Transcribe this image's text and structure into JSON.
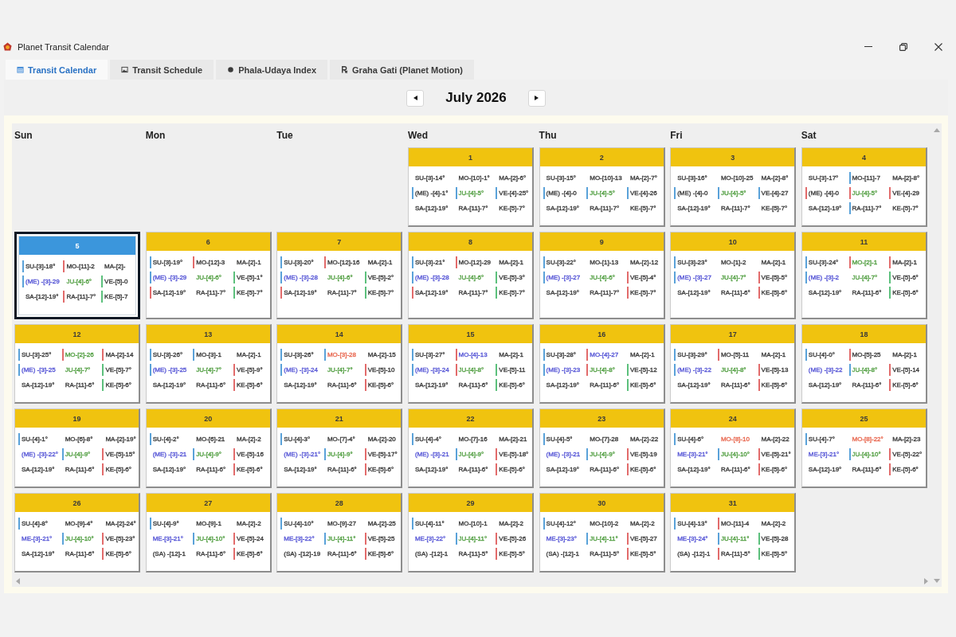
{
  "window": {
    "title": "Planet Transit Calendar"
  },
  "tabs": [
    {
      "label": "Transit Calendar",
      "selected": true
    },
    {
      "label": "Transit Schedule",
      "selected": false
    },
    {
      "label": "Phala-Udaya Index",
      "selected": false
    },
    {
      "label": "Graha Gati (Planet Motion)",
      "selected": false
    }
  ],
  "calendar": {
    "month": "July 2026",
    "weekdays": [
      "Sun",
      "Mon",
      "Tue",
      "Wed",
      "Thu",
      "Fri",
      "Sat"
    ],
    "weeks": [
      [
        {
          "kind": "blank"
        },
        {
          "kind": "blank"
        },
        {
          "kind": "blank"
        },
        {
          "kind": "day",
          "date": "1",
          "selected": false,
          "entries": [
            {
              "text": "SU-[3]-14°"
            },
            {
              "text": "MO-[10]-1°"
            },
            {
              "text": "MA-[2]-6°"
            },
            {
              "text": "(ME) -[4]-1°",
              "marker": {
                "color": "#5aa2d9"
              }
            },
            {
              "text": "JU-[4]-5°",
              "marker": {
                "color": "#5aa2d9"
              },
              "color": "#4f9d3f"
            },
            {
              "text": "VE-[4]-25°",
              "marker": {
                "color": "#5aa2d9"
              }
            },
            {
              "text": "SA-[12]-19°"
            },
            {
              "text": "RA-[11]-7°"
            },
            {
              "text": "KE-[5]-7°"
            }
          ]
        },
        {
          "kind": "day",
          "date": "2",
          "selected": false,
          "entries": [
            {
              "text": "SU-[3]-15°"
            },
            {
              "text": "MO-[10]-13"
            },
            {
              "text": "MA-[2]-7°"
            },
            {
              "text": "(ME) -[4]-0",
              "marker": {
                "color": "#5aa2d9"
              }
            },
            {
              "text": "JU-[4]-5°",
              "marker": {
                "color": "#5aa2d9"
              },
              "color": "#4f9d3f"
            },
            {
              "text": "VE-[4]-26",
              "marker": {
                "color": "#5aa2d9"
              }
            },
            {
              "text": "SA-[12]-19°"
            },
            {
              "text": "RA-[11]-7°"
            },
            {
              "text": "KE-[5]-7°"
            }
          ]
        },
        {
          "kind": "day",
          "date": "3",
          "selected": false,
          "entries": [
            {
              "text": "SU-[3]-16°"
            },
            {
              "text": "MO-[10]-25"
            },
            {
              "text": "MA-[2]-8°"
            },
            {
              "text": "(ME) -[4]-0",
              "marker": {
                "color": "#5aa2d9"
              }
            },
            {
              "text": "JU-[4]-5°",
              "marker": {
                "color": "#5aa2d9"
              },
              "color": "#4f9d3f"
            },
            {
              "text": "VE-[4]-27",
              "marker": {
                "color": "#5aa2d9"
              }
            },
            {
              "text": "SA-[12]-19°"
            },
            {
              "text": "RA-[11]-7°"
            },
            {
              "text": "KE-[5]-7°"
            }
          ]
        },
        {
          "kind": "day",
          "date": "4",
          "selected": false,
          "entries": [
            {
              "text": "SU-[3]-17°"
            },
            {
              "text": "MO-[11]-7",
              "marker": {
                "color": "#5aa2d9"
              }
            },
            {
              "text": "MA-[2]-8°"
            },
            {
              "text": "(ME) -[4]-0",
              "marker": {
                "color": "#e26b6b"
              }
            },
            {
              "text": "JU-[4]-5°",
              "marker": {
                "color": "#e26b6b"
              },
              "color": "#4f9d3f"
            },
            {
              "text": "VE-[4]-29",
              "marker": {
                "color": "#e26b6b"
              }
            },
            {
              "text": "SA-[12]-19°"
            },
            {
              "text": "RA-[11]-7°",
              "marker": {
                "color": "#5aa2d9"
              }
            },
            {
              "text": "KE-[5]-7°"
            }
          ]
        }
      ],
      [
        {
          "kind": "day",
          "date": "5",
          "selected": true,
          "entries": [
            {
              "text": "SU-[3]-18°",
              "marker": {
                "color": "#5aa2d9"
              }
            },
            {
              "text": "MO-[11]-2",
              "marker": {
                "color": "#e26b6b"
              }
            },
            {
              "text": "MA-[2]-"
            },
            {
              "text": "(ME) -[3]-29",
              "marker": {
                "color": "#5aa2d9"
              },
              "color": "#5656d6"
            },
            {
              "text": "JU-[4]-6°",
              "color": "#4f9d3f"
            },
            {
              "text": "VE-[5]-0",
              "marker": {
                "color": "#5cc07c"
              }
            },
            {
              "text": "SA-[12]-19°"
            },
            {
              "text": "RA-[11]-7°",
              "marker": {
                "color": "#e26b6b"
              }
            },
            {
              "text": "KE-[5]-7",
              "marker": {
                "color": "#5cc07c"
              }
            }
          ]
        },
        {
          "kind": "day",
          "date": "6",
          "selected": false,
          "entries": [
            {
              "text": "SU-[3]-19°",
              "marker": {
                "color": "#5aa2d9"
              }
            },
            {
              "text": "MO-[12]-3",
              "marker": {
                "color": "#e26b6b"
              }
            },
            {
              "text": "MA-[2]-1"
            },
            {
              "text": "(ME) -[3]-29",
              "marker": {
                "color": "#5aa2d9"
              },
              "color": "#5656d6"
            },
            {
              "text": "JU-[4]-6°",
              "color": "#4f9d3f"
            },
            {
              "text": "VE-[5]-1°",
              "marker": {
                "color": "#5cc07c"
              }
            },
            {
              "text": "SA-[12]-19°",
              "marker": {
                "color": "#e26b6b"
              }
            },
            {
              "text": "RA-[11]-7°"
            },
            {
              "text": "KE-[5]-7°",
              "marker": {
                "color": "#5cc07c"
              }
            }
          ]
        },
        {
          "kind": "day",
          "date": "7",
          "selected": false,
          "entries": [
            {
              "text": "SU-[3]-20°",
              "marker": {
                "color": "#5aa2d9"
              }
            },
            {
              "text": "MO-[12]-16",
              "marker": {
                "color": "#e26b6b"
              }
            },
            {
              "text": "MA-[2]-1"
            },
            {
              "text": "(ME) -[3]-28",
              "marker": {
                "color": "#5aa2d9"
              },
              "color": "#5656d6"
            },
            {
              "text": "JU-[4]-6°",
              "color": "#4f9d3f"
            },
            {
              "text": "VE-[5]-2°",
              "marker": {
                "color": "#5cc07c"
              }
            },
            {
              "text": "SA-[12]-19°",
              "marker": {
                "color": "#e26b6b"
              }
            },
            {
              "text": "RA-[11]-7°"
            },
            {
              "text": "KE-[5]-7°",
              "marker": {
                "color": "#5cc07c"
              }
            }
          ]
        },
        {
          "kind": "day",
          "date": "8",
          "selected": false,
          "entries": [
            {
              "text": "SU-[3]-21°",
              "marker": {
                "color": "#5aa2d9"
              }
            },
            {
              "text": "MO-[12]-29",
              "marker": {
                "color": "#e26b6b"
              }
            },
            {
              "text": "MA-[2]-1"
            },
            {
              "text": "(ME) -[3]-28",
              "marker": {
                "color": "#5aa2d9"
              },
              "color": "#5656d6"
            },
            {
              "text": "JU-[4]-6°",
              "color": "#4f9d3f"
            },
            {
              "text": "VE-[5]-3°",
              "marker": {
                "color": "#5cc07c"
              }
            },
            {
              "text": "SA-[12]-19°",
              "marker": {
                "color": "#e26b6b"
              }
            },
            {
              "text": "RA-[11]-7°"
            },
            {
              "text": "KE-[5]-7°",
              "marker": {
                "color": "#5cc07c"
              }
            }
          ]
        },
        {
          "kind": "day",
          "date": "9",
          "selected": false,
          "entries": [
            {
              "text": "SU-[3]-22°",
              "marker": {
                "color": "#5aa2d9"
              }
            },
            {
              "text": "MO-[1]-13"
            },
            {
              "text": "MA-[2]-12"
            },
            {
              "text": "(ME) -[3]-27",
              "marker": {
                "color": "#5aa2d9"
              },
              "color": "#5656d6"
            },
            {
              "text": "JU-[4]-6°",
              "color": "#4f9d3f"
            },
            {
              "text": "VE-[5]-4°",
              "marker": {
                "color": "#e26b6b"
              }
            },
            {
              "text": "SA-[12]-19°"
            },
            {
              "text": "RA-[11]-7°"
            },
            {
              "text": "KE-[5]-7°",
              "marker": {
                "color": "#e26b6b"
              }
            }
          ]
        },
        {
          "kind": "day",
          "date": "10",
          "selected": false,
          "entries": [
            {
              "text": "SU-[3]-23°",
              "marker": {
                "color": "#5aa2d9"
              }
            },
            {
              "text": "MO-[1]-2"
            },
            {
              "text": "MA-[2]-1"
            },
            {
              "text": "(ME) -[3]-27",
              "marker": {
                "color": "#5aa2d9"
              },
              "color": "#5656d6"
            },
            {
              "text": "JU-[4]-7°",
              "color": "#4f9d3f"
            },
            {
              "text": "VE-[5]-5°",
              "marker": {
                "color": "#e26b6b"
              }
            },
            {
              "text": "SA-[12]-19°"
            },
            {
              "text": "RA-[11]-6°"
            },
            {
              "text": "KE-[5]-6°",
              "marker": {
                "color": "#e26b6b"
              }
            }
          ]
        },
        {
          "kind": "day",
          "date": "11",
          "selected": false,
          "entries": [
            {
              "text": "SU-[3]-24°",
              "marker": {
                "color": "#5aa2d9"
              }
            },
            {
              "text": "MO-[2]-1",
              "marker": {
                "color": "#e26b6b"
              },
              "color": "#4f9d3f"
            },
            {
              "text": "MA-[2]-1",
              "marker": {
                "color": "#e26b6b"
              }
            },
            {
              "text": "(ME) -[3]-2",
              "marker": {
                "color": "#5aa2d9"
              },
              "color": "#5656d6"
            },
            {
              "text": "JU-[4]-7°",
              "color": "#4f9d3f"
            },
            {
              "text": "VE-[5]-6°",
              "marker": {
                "color": "#5cc07c"
              }
            },
            {
              "text": "SA-[12]-19°"
            },
            {
              "text": "RA-[11]-6°"
            },
            {
              "text": "KE-[5]-6°",
              "marker": {
                "color": "#5cc07c"
              }
            }
          ]
        }
      ],
      [
        {
          "kind": "day",
          "date": "12",
          "selected": false,
          "entries": [
            {
              "text": "SU-[3]-25°",
              "marker": {
                "color": "#5aa2d9"
              }
            },
            {
              "text": "MO-[2]-26",
              "marker": {
                "color": "#e26b6b"
              },
              "color": "#4f9d3f"
            },
            {
              "text": "MA-[2]-14",
              "marker": {
                "color": "#e26b6b"
              }
            },
            {
              "text": "(ME) -[3]-25",
              "marker": {
                "color": "#5aa2d9"
              },
              "color": "#5656d6"
            },
            {
              "text": "JU-[4]-7°",
              "color": "#4f9d3f"
            },
            {
              "text": "VE-[5]-7°",
              "marker": {
                "color": "#5cc07c"
              }
            },
            {
              "text": "SA-[12]-19°"
            },
            {
              "text": "RA-[11]-6°"
            },
            {
              "text": "KE-[5]-6°",
              "marker": {
                "color": "#5cc07c"
              }
            }
          ]
        },
        {
          "kind": "day",
          "date": "13",
          "selected": false,
          "entries": [
            {
              "text": "SU-[3]-26°",
              "marker": {
                "color": "#5aa2d9"
              }
            },
            {
              "text": "MO-[3]-1",
              "marker": {
                "color": "#5aa2d9"
              }
            },
            {
              "text": "MA-[2]-1"
            },
            {
              "text": "(ME) -[3]-25",
              "marker": {
                "color": "#5aa2d9"
              },
              "color": "#5656d6"
            },
            {
              "text": "JU-[4]-7°",
              "color": "#4f9d3f"
            },
            {
              "text": "VE-[5]-9°",
              "marker": {
                "color": "#e26b6b"
              }
            },
            {
              "text": "SA-[12]-19°"
            },
            {
              "text": "RA-[11]-6°"
            },
            {
              "text": "KE-[5]-6°",
              "marker": {
                "color": "#e26b6b"
              }
            }
          ]
        },
        {
          "kind": "day",
          "date": "14",
          "selected": false,
          "entries": [
            {
              "text": "SU-[3]-26°",
              "marker": {
                "color": "#5aa2d9"
              }
            },
            {
              "text": "MO-[3]-28",
              "marker": {
                "color": "#5aa2d9"
              },
              "color": "#e8674f"
            },
            {
              "text": "MA-[2]-15"
            },
            {
              "text": "(ME) -[3]-24",
              "marker": {
                "color": "#5aa2d9"
              },
              "color": "#5656d6"
            },
            {
              "text": "JU-[4]-7°",
              "color": "#4f9d3f"
            },
            {
              "text": "VE-[5]-10",
              "marker": {
                "color": "#e26b6b"
              }
            },
            {
              "text": "SA-[12]-19°"
            },
            {
              "text": "RA-[11]-6°"
            },
            {
              "text": "KE-[5]-6°",
              "marker": {
                "color": "#e26b6b"
              }
            }
          ]
        },
        {
          "kind": "day",
          "date": "15",
          "selected": false,
          "entries": [
            {
              "text": "SU-[3]-27°",
              "marker": {
                "color": "#5aa2d9"
              }
            },
            {
              "text": "MO-[4]-13",
              "marker": {
                "color": "#e26b6b"
              },
              "color": "#5656d6"
            },
            {
              "text": "MA-[2]-1"
            },
            {
              "text": "(ME) -[3]-24",
              "marker": {
                "color": "#5aa2d9"
              },
              "color": "#5656d6"
            },
            {
              "text": "JU-[4]-8°",
              "marker": {
                "color": "#e26b6b"
              },
              "color": "#4f9d3f"
            },
            {
              "text": "VE-[5]-11",
              "marker": {
                "color": "#5cc07c"
              }
            },
            {
              "text": "SA-[12]-19°"
            },
            {
              "text": "RA-[11]-6°"
            },
            {
              "text": "KE-[5]-6°",
              "marker": {
                "color": "#5cc07c"
              }
            }
          ]
        },
        {
          "kind": "day",
          "date": "16",
          "selected": false,
          "entries": [
            {
              "text": "SU-[3]-28°",
              "marker": {
                "color": "#5aa2d9"
              }
            },
            {
              "text": "MO-[4]-27",
              "marker": {
                "color": "#e26b6b"
              },
              "color": "#5656d6"
            },
            {
              "text": "MA-[2]-1"
            },
            {
              "text": "(ME) -[3]-23",
              "marker": {
                "color": "#5aa2d9"
              },
              "color": "#5656d6"
            },
            {
              "text": "JU-[4]-8°",
              "marker": {
                "color": "#e26b6b"
              },
              "color": "#4f9d3f"
            },
            {
              "text": "VE-[5]-12",
              "marker": {
                "color": "#5cc07c"
              }
            },
            {
              "text": "SA-[12]-19°"
            },
            {
              "text": "RA-[11]-6°"
            },
            {
              "text": "KE-[5]-6°",
              "marker": {
                "color": "#5cc07c"
              }
            }
          ]
        },
        {
          "kind": "day",
          "date": "17",
          "selected": false,
          "entries": [
            {
              "text": "SU-[3]-29°",
              "marker": {
                "color": "#5aa2d9"
              }
            },
            {
              "text": "MO-[5]-11",
              "marker": {
                "color": "#e26b6b"
              }
            },
            {
              "text": "MA-[2]-1"
            },
            {
              "text": "(ME) -[3]-22",
              "marker": {
                "color": "#5aa2d9"
              },
              "color": "#5656d6"
            },
            {
              "text": "JU-[4]-8°",
              "color": "#4f9d3f"
            },
            {
              "text": "VE-[5]-13",
              "marker": {
                "color": "#e26b6b"
              }
            },
            {
              "text": "SA-[12]-19°"
            },
            {
              "text": "RA-[11]-6°"
            },
            {
              "text": "KE-[5]-6°",
              "marker": {
                "color": "#e26b6b"
              }
            }
          ]
        },
        {
          "kind": "day",
          "date": "18",
          "selected": false,
          "entries": [
            {
              "text": "SU-[4]-0°",
              "marker": {
                "color": "#5aa2d9"
              }
            },
            {
              "text": "MO-[5]-25",
              "marker": {
                "color": "#e26b6b"
              }
            },
            {
              "text": "MA-[2]-1"
            },
            {
              "text": "(ME) -[3]-22",
              "color": "#5656d6"
            },
            {
              "text": "JU-[4]-8°",
              "marker": {
                "color": "#5aa2d9"
              },
              "color": "#4f9d3f"
            },
            {
              "text": "VE-[5]-14",
              "marker": {
                "color": "#e26b6b"
              }
            },
            {
              "text": "SA-[12]-19°"
            },
            {
              "text": "RA-[11]-6°"
            },
            {
              "text": "KE-[5]-6°",
              "marker": {
                "color": "#e26b6b"
              }
            }
          ]
        }
      ],
      [
        {
          "kind": "day",
          "date": "19",
          "selected": false,
          "entries": [
            {
              "text": "SU-[4]-1°",
              "marker": {
                "color": "#5aa2d9"
              }
            },
            {
              "text": "MO-[6]-8°"
            },
            {
              "text": "MA-[2]-19°"
            },
            {
              "text": "(ME) -[3]-22°",
              "color": "#5656d6"
            },
            {
              "text": "JU-[4]-9°",
              "marker": {
                "color": "#5aa2d9"
              },
              "color": "#4f9d3f"
            },
            {
              "text": "VE-[5]-15°",
              "marker": {
                "color": "#e26b6b"
              }
            },
            {
              "text": "SA-[12]-19°"
            },
            {
              "text": "RA-[11]-6°"
            },
            {
              "text": "KE-[5]-6°",
              "marker": {
                "color": "#e26b6b"
              }
            }
          ]
        },
        {
          "kind": "day",
          "date": "20",
          "selected": false,
          "entries": [
            {
              "text": "SU-[4]-2°",
              "marker": {
                "color": "#5aa2d9"
              }
            },
            {
              "text": "MO-[6]-21"
            },
            {
              "text": "MA-[2]-2"
            },
            {
              "text": "(ME) -[3]-21",
              "color": "#5656d6"
            },
            {
              "text": "JU-[4]-9°",
              "marker": {
                "color": "#5aa2d9"
              },
              "color": "#4f9d3f"
            },
            {
              "text": "VE-[5]-16",
              "marker": {
                "color": "#e26b6b"
              }
            },
            {
              "text": "SA-[12]-19°"
            },
            {
              "text": "RA-[11]-6°"
            },
            {
              "text": "KE-[5]-6°",
              "marker": {
                "color": "#e26b6b"
              }
            }
          ]
        },
        {
          "kind": "day",
          "date": "21",
          "selected": false,
          "entries": [
            {
              "text": "SU-[4]-3°",
              "marker": {
                "color": "#5aa2d9"
              }
            },
            {
              "text": "MO-[7]-4°"
            },
            {
              "text": "MA-[2]-20"
            },
            {
              "text": "(ME) -[3]-21°",
              "color": "#5656d6"
            },
            {
              "text": "JU-[4]-9°",
              "marker": {
                "color": "#5aa2d9"
              },
              "color": "#4f9d3f"
            },
            {
              "text": "VE-[5]-17°",
              "marker": {
                "color": "#e26b6b"
              }
            },
            {
              "text": "SA-[12]-19°"
            },
            {
              "text": "RA-[11]-6°"
            },
            {
              "text": "KE-[5]-6°",
              "marker": {
                "color": "#e26b6b"
              }
            }
          ]
        },
        {
          "kind": "day",
          "date": "22",
          "selected": false,
          "entries": [
            {
              "text": "SU-[4]-4°",
              "marker": {
                "color": "#5aa2d9"
              }
            },
            {
              "text": "MO-[7]-16"
            },
            {
              "text": "MA-[2]-21"
            },
            {
              "text": "(ME) -[3]-21",
              "color": "#5656d6"
            },
            {
              "text": "JU-[4]-9°",
              "marker": {
                "color": "#5aa2d9"
              },
              "color": "#4f9d3f"
            },
            {
              "text": "VE-[5]-18°",
              "marker": {
                "color": "#e26b6b"
              }
            },
            {
              "text": "SA-[12]-19°"
            },
            {
              "text": "RA-[11]-6°"
            },
            {
              "text": "KE-[5]-6°",
              "marker": {
                "color": "#e26b6b"
              }
            }
          ]
        },
        {
          "kind": "day",
          "date": "23",
          "selected": false,
          "entries": [
            {
              "text": "SU-[4]-5°",
              "marker": {
                "color": "#5aa2d9"
              }
            },
            {
              "text": "MO-[7]-28"
            },
            {
              "text": "MA-[2]-22"
            },
            {
              "text": "(ME) -[3]-21",
              "color": "#5656d6"
            },
            {
              "text": "JU-[4]-9°",
              "marker": {
                "color": "#5aa2d9"
              },
              "color": "#4f9d3f"
            },
            {
              "text": "VE-[5]-19",
              "marker": {
                "color": "#e26b6b"
              }
            },
            {
              "text": "SA-[12]-19°"
            },
            {
              "text": "RA-[11]-6°"
            },
            {
              "text": "KE-[5]-6°",
              "marker": {
                "color": "#e26b6b"
              }
            }
          ]
        },
        {
          "kind": "day",
          "date": "24",
          "selected": false,
          "entries": [
            {
              "text": "SU-[4]-6°",
              "marker": {
                "color": "#5aa2d9"
              }
            },
            {
              "text": "MO-[8]-10",
              "color": "#e8674f"
            },
            {
              "text": "MA-[2]-22"
            },
            {
              "text": "ME-[3]-21°",
              "color": "#5656d6"
            },
            {
              "text": "JU-[4]-10°",
              "marker": {
                "color": "#5aa2d9"
              },
              "color": "#4f9d3f"
            },
            {
              "text": "VE-[5]-21°",
              "marker": {
                "color": "#e26b6b"
              }
            },
            {
              "text": "SA-[12]-19°"
            },
            {
              "text": "RA-[11]-6°"
            },
            {
              "text": "KE-[5]-6°",
              "marker": {
                "color": "#e26b6b"
              }
            }
          ]
        },
        {
          "kind": "day",
          "date": "25",
          "selected": false,
          "entries": [
            {
              "text": "SU-[4]-7°",
              "marker": {
                "color": "#5aa2d9"
              }
            },
            {
              "text": "MO-[8]-22°",
              "color": "#e8674f"
            },
            {
              "text": "MA-[2]-23"
            },
            {
              "text": "ME-[3]-21°",
              "color": "#5656d6"
            },
            {
              "text": "JU-[4]-10°",
              "marker": {
                "color": "#5aa2d9"
              },
              "color": "#4f9d3f"
            },
            {
              "text": "VE-[5]-22°",
              "marker": {
                "color": "#e26b6b"
              }
            },
            {
              "text": "SA-[12]-19°"
            },
            {
              "text": "RA-[11]-6°"
            },
            {
              "text": "KE-[5]-6°",
              "marker": {
                "color": "#e26b6b"
              }
            }
          ]
        }
      ],
      [
        {
          "kind": "day",
          "date": "26",
          "selected": false,
          "entries": [
            {
              "text": "SU-[4]-8°",
              "marker": {
                "color": "#5aa2d9"
              }
            },
            {
              "text": "MO-[9]-4°"
            },
            {
              "text": "MA-[2]-24°"
            },
            {
              "text": "ME-[3]-21°",
              "color": "#5656d6"
            },
            {
              "text": "JU-[4]-10°",
              "marker": {
                "color": "#5aa2d9"
              },
              "color": "#4f9d3f"
            },
            {
              "text": "VE-[5]-23°",
              "marker": {
                "color": "#e26b6b"
              }
            },
            {
              "text": "SA-[12]-19°"
            },
            {
              "text": "RA-[11]-6°"
            },
            {
              "text": "KE-[5]-6°",
              "marker": {
                "color": "#e26b6b"
              }
            }
          ]
        },
        {
          "kind": "day",
          "date": "27",
          "selected": false,
          "entries": [
            {
              "text": "SU-[4]-9°",
              "marker": {
                "color": "#5aa2d9"
              }
            },
            {
              "text": "MO-[9]-1"
            },
            {
              "text": "MA-[2]-2"
            },
            {
              "text": "ME-[3]-21°",
              "color": "#5656d6"
            },
            {
              "text": "JU-[4]-10°",
              "marker": {
                "color": "#5aa2d9"
              },
              "color": "#4f9d3f"
            },
            {
              "text": "VE-[5]-24",
              "marker": {
                "color": "#e26b6b"
              }
            },
            {
              "text": "(SA) -[12]-1"
            },
            {
              "text": "RA-[11]-6°"
            },
            {
              "text": "KE-[5]-6°",
              "marker": {
                "color": "#e26b6b"
              }
            }
          ]
        },
        {
          "kind": "day",
          "date": "28",
          "selected": false,
          "entries": [
            {
              "text": "SU-[4]-10°",
              "marker": {
                "color": "#5aa2d9"
              }
            },
            {
              "text": "MO-[9]-27"
            },
            {
              "text": "MA-[2]-25"
            },
            {
              "text": "ME-[3]-22°",
              "color": "#5656d6"
            },
            {
              "text": "JU-[4]-11°",
              "marker": {
                "color": "#5aa2d9"
              },
              "color": "#4f9d3f"
            },
            {
              "text": "VE-[5]-25",
              "marker": {
                "color": "#e26b6b"
              }
            },
            {
              "text": "(SA) -[12]-19"
            },
            {
              "text": "RA-[11]-6°"
            },
            {
              "text": "KE-[5]-6°",
              "marker": {
                "color": "#e26b6b"
              }
            }
          ]
        },
        {
          "kind": "day",
          "date": "29",
          "selected": false,
          "entries": [
            {
              "text": "SU-[4]-11°",
              "marker": {
                "color": "#5aa2d9"
              }
            },
            {
              "text": "MO-[10]-1"
            },
            {
              "text": "MA-[2]-2"
            },
            {
              "text": "ME-[3]-22°",
              "color": "#5656d6"
            },
            {
              "text": "JU-[4]-11°",
              "marker": {
                "color": "#5aa2d9"
              },
              "color": "#4f9d3f"
            },
            {
              "text": "VE-[5]-26",
              "marker": {
                "color": "#e26b6b"
              }
            },
            {
              "text": "(SA) -[12]-1"
            },
            {
              "text": "RA-[11]-5°"
            },
            {
              "text": "KE-[5]-5°",
              "marker": {
                "color": "#e26b6b"
              }
            }
          ]
        },
        {
          "kind": "day",
          "date": "30",
          "selected": false,
          "entries": [
            {
              "text": "SU-[4]-12°",
              "marker": {
                "color": "#5aa2d9"
              }
            },
            {
              "text": "MO-[10]-2"
            },
            {
              "text": "MA-[2]-2"
            },
            {
              "text": "ME-[3]-23°",
              "color": "#5656d6"
            },
            {
              "text": "JU-[4]-11°",
              "marker": {
                "color": "#5aa2d9"
              },
              "color": "#4f9d3f"
            },
            {
              "text": "VE-[5]-27",
              "marker": {
                "color": "#e26b6b"
              }
            },
            {
              "text": "(SA) -[12]-1"
            },
            {
              "text": "RA-[11]-5°"
            },
            {
              "text": "KE-[5]-5°",
              "marker": {
                "color": "#e26b6b"
              }
            }
          ]
        },
        {
          "kind": "day",
          "date": "31",
          "selected": false,
          "entries": [
            {
              "text": "SU-[4]-13°",
              "marker": {
                "color": "#5aa2d9"
              }
            },
            {
              "text": "MO-[11]-4",
              "marker": {
                "color": "#e26b6b"
              }
            },
            {
              "text": "MA-[2]-2"
            },
            {
              "text": "ME-[3]-24°",
              "color": "#5656d6"
            },
            {
              "text": "JU-[4]-11°",
              "marker": {
                "color": "#5aa2d9"
              },
              "color": "#4f9d3f"
            },
            {
              "text": "VE-[5]-28",
              "marker": {
                "color": "#5cc07c"
              }
            },
            {
              "text": "(SA) -[12]-1"
            },
            {
              "text": "RA-[11]-5°",
              "marker": {
                "color": "#e26b6b"
              }
            },
            {
              "text": "KE-[5]-5°",
              "marker": {
                "color": "#5cc07c"
              }
            }
          ]
        },
        {
          "kind": "blank"
        }
      ]
    ]
  }
}
